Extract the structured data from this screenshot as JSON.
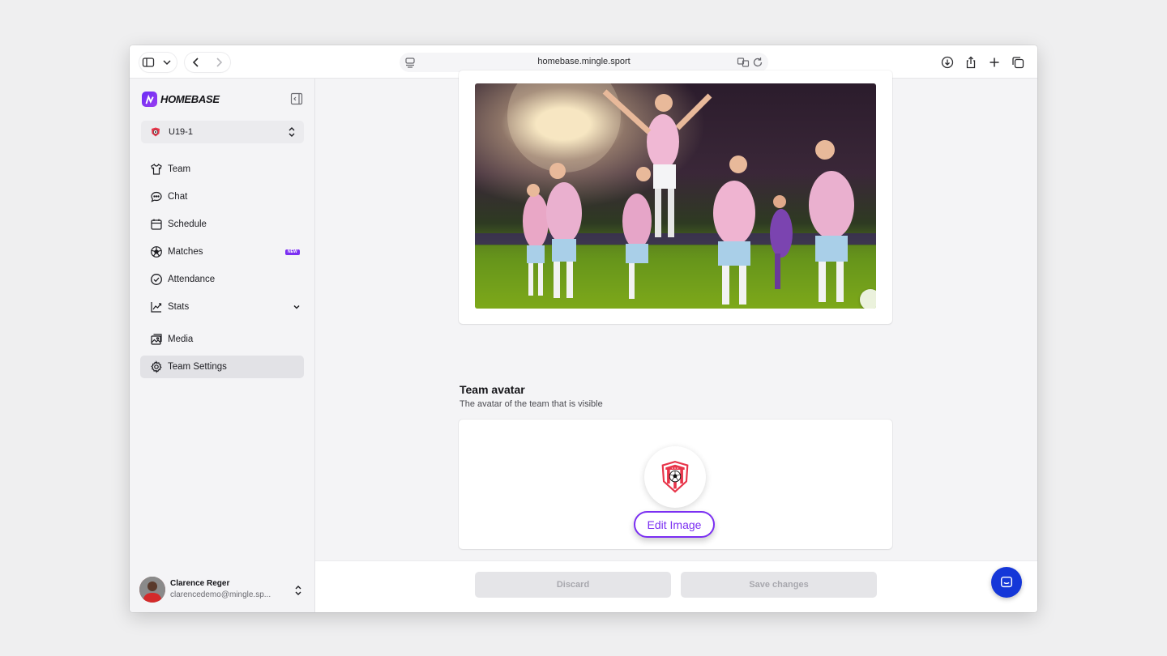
{
  "browser": {
    "url": "homebase.mingle.sport"
  },
  "sidebar": {
    "logo_text": "HOMEBASE",
    "team_selector": {
      "name": "U19-1"
    },
    "items": [
      {
        "label": "Team",
        "icon": "shirt-icon"
      },
      {
        "label": "Chat",
        "icon": "chat-bubble-icon"
      },
      {
        "label": "Schedule",
        "icon": "calendar-icon"
      },
      {
        "label": "Matches",
        "icon": "soccer-ball-icon",
        "badge": "NEW"
      },
      {
        "label": "Attendance",
        "icon": "check-circle-icon"
      },
      {
        "label": "Stats",
        "icon": "line-chart-icon"
      },
      {
        "label": "Media",
        "icon": "images-icon"
      },
      {
        "label": "Team Settings",
        "icon": "gear-icon",
        "active": true
      }
    ],
    "user": {
      "name": "Clarence Reger",
      "email": "clarencedemo@mingle.sp..."
    }
  },
  "main": {
    "avatar_section": {
      "title": "Team avatar",
      "description": "The avatar of the team that is visible",
      "edit_label": "Edit Image"
    }
  },
  "footer": {
    "discard_label": "Discard",
    "save_label": "Save changes"
  },
  "colors": {
    "accent": "#7b2ff2",
    "chat_fab": "#1537d8"
  }
}
